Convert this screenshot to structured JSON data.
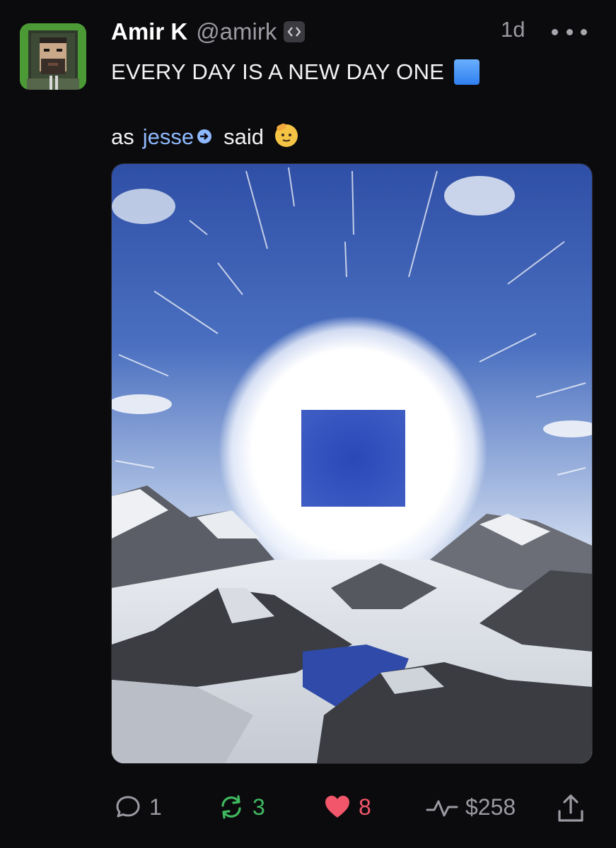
{
  "author": {
    "display_name": "Amir K",
    "handle": "@amirk",
    "avatar_icon": "pixel-art-bearded-hooded-man-avatar",
    "badge_icon": "code-brackets-badge-icon"
  },
  "post": {
    "time": "1d",
    "line1": "EVERY DAY IS A NEW DAY ONE",
    "line1_emoji": "blue-square-emoji",
    "line2_prefix": "as",
    "mention": "jesse",
    "line2_suffix": "said",
    "line2_emoji": "saluting-face-emoji",
    "image_icon": "glowing-blue-square-over-snowy-mountains-image"
  },
  "actions": {
    "replies": "1",
    "recasts": "3",
    "likes": "8",
    "tips": "$258"
  },
  "colors": {
    "background": "#0b0b0d",
    "mention": "#8fb9ff",
    "recast": "#3fb95f",
    "like": "#f2566a",
    "muted": "#9a9aa2"
  }
}
